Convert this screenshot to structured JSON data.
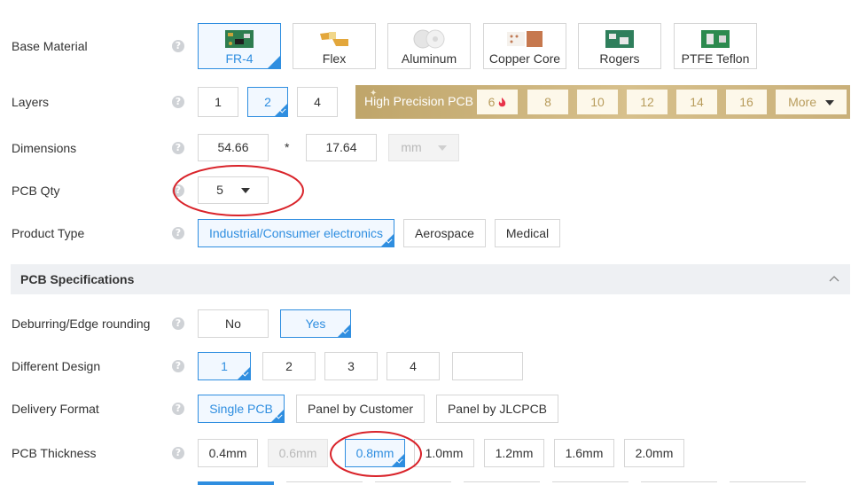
{
  "help_glyph": "?",
  "base_material": {
    "label": "Base Material",
    "options": [
      {
        "name": "FR-4",
        "selected": true
      },
      {
        "name": "Flex",
        "selected": false
      },
      {
        "name": "Aluminum",
        "selected": false
      },
      {
        "name": "Copper Core",
        "selected": false
      },
      {
        "name": "Rogers",
        "selected": false
      },
      {
        "name": "PTFE Teflon",
        "selected": false
      }
    ]
  },
  "layers": {
    "label": "Layers",
    "options": [
      "1",
      "2",
      "4"
    ],
    "selected": "2",
    "high_precision": {
      "title": "High Precision PCB",
      "options": [
        "6",
        "8",
        "10",
        "12",
        "14",
        "16"
      ],
      "more_label": "More"
    }
  },
  "dimensions": {
    "label": "Dimensions",
    "width": "54.66",
    "separator": "*",
    "height": "17.64",
    "unit": "mm"
  },
  "pcb_qty": {
    "label": "PCB Qty",
    "value": "5"
  },
  "product_type": {
    "label": "Product Type",
    "options": [
      "Industrial/Consumer electronics",
      "Aerospace",
      "Medical"
    ],
    "selected": "Industrial/Consumer electronics"
  },
  "section": {
    "title": "PCB Specifications",
    "chevron": "chevron-up-icon"
  },
  "deburring": {
    "label": "Deburring/Edge rounding",
    "options": [
      "No",
      "Yes"
    ],
    "selected": "Yes"
  },
  "different_design": {
    "label": "Different Design",
    "options": [
      "1",
      "2",
      "3",
      "4"
    ],
    "custom_value": "",
    "selected": "1"
  },
  "delivery_format": {
    "label": "Delivery Format",
    "options": [
      "Single PCB",
      "Panel by Customer",
      "Panel by JLCPCB"
    ],
    "selected": "Single PCB"
  },
  "pcb_thickness": {
    "label": "PCB Thickness",
    "options": [
      "0.4mm",
      "0.6mm",
      "0.8mm",
      "1.0mm",
      "1.2mm",
      "1.6mm",
      "2.0mm"
    ],
    "selected": "0.8mm",
    "disabled": [
      "0.6mm"
    ]
  },
  "colors": {
    "accent": "#2f8ee0",
    "gold": "#c9b07a",
    "highlight_circle": "#d9232a",
    "flame": "#e8334a"
  }
}
